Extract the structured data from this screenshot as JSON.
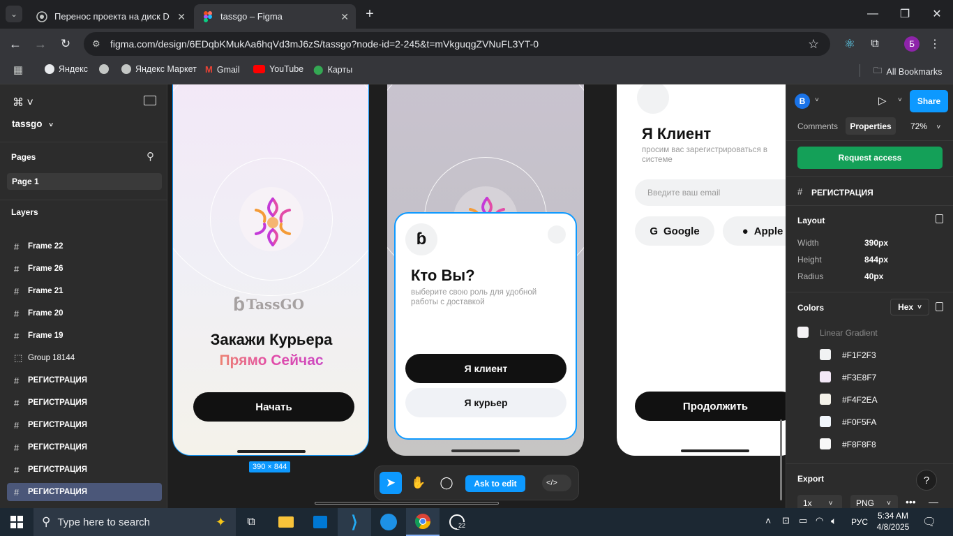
{
  "browser": {
    "tabs": [
      {
        "title": "Перенос проекта на диск D",
        "active": false
      },
      {
        "title": "tassgo – Figma",
        "active": true
      }
    ],
    "url": "figma.com/design/6EDqbKMukAa6hqVd3mJ6zS/tassgo?node-id=2-245&t=mVkguqgZVNuFL3YT-0",
    "profile_letter": "Б",
    "bookmarks": [
      "Яндекс",
      "Яндекс Маркет",
      "Gmail",
      "YouTube",
      "Карты"
    ],
    "all_bookmarks": "All Bookmarks"
  },
  "figma": {
    "file_name": "tassgo",
    "pages_heading": "Pages",
    "page_1": "Page 1",
    "layers_heading": "Layers",
    "layers": [
      {
        "name": "Frame 22",
        "kind": "frame"
      },
      {
        "name": "Frame 26",
        "kind": "frame"
      },
      {
        "name": "Frame 21",
        "kind": "frame"
      },
      {
        "name": "Frame 20",
        "kind": "frame"
      },
      {
        "name": "Frame 19",
        "kind": "frame"
      },
      {
        "name": "Group 18144",
        "kind": "group"
      },
      {
        "name": "РЕГИСТРАЦИЯ",
        "kind": "frame"
      },
      {
        "name": "РЕГИСТРАЦИЯ",
        "kind": "frame"
      },
      {
        "name": "РЕГИСТРАЦИЯ",
        "kind": "frame"
      },
      {
        "name": "РЕГИСТРАЦИЯ",
        "kind": "frame"
      },
      {
        "name": "РЕГИСТРАЦИЯ",
        "kind": "frame"
      },
      {
        "name": "РЕГИСТРАЦИЯ",
        "kind": "frame",
        "selected": true
      }
    ],
    "canvas": {
      "frame1": {
        "logo_text": "TassGO",
        "headline1": "Закажи Курьера",
        "headline2": "Прямо Сейчас",
        "button": "Начать",
        "size_badge": "390 × 844"
      },
      "frame2": {
        "title": "Кто Вы?",
        "subtitle": "выберите свою роль для удобной работы с доставкой",
        "btn_client": "Я клиент",
        "btn_courier": "Я курьер"
      },
      "frame3": {
        "title": "Я Клиент",
        "subtitle": "просим вас зарегистрироваться в системе",
        "email_placeholder": "Введите ваш email",
        "google": "Google",
        "apple": "Apple",
        "continue": "Продолжить"
      }
    },
    "bottom_toolbar": {
      "ask_to_edit": "Ask to edit"
    },
    "right": {
      "avatar": "B",
      "share": "Share",
      "tab_comments": "Comments",
      "tab_properties": "Properties",
      "zoom": "72%",
      "request_access": "Request access",
      "selection_name": "РЕГИСТРАЦИЯ",
      "layout_heading": "Layout",
      "width_label": "Width",
      "width_value": "390px",
      "height_label": "Height",
      "height_value": "844px",
      "radius_label": "Radius",
      "radius_value": "40px",
      "colors_heading": "Colors",
      "color_format": "Hex",
      "gradient_label": "Linear Gradient",
      "colors": [
        "#F1F2F3",
        "#F3E8F7",
        "#F4F2EA",
        "#F0F5FA",
        "#F8F8F8"
      ],
      "export_heading": "Export",
      "export_scale": "1x",
      "export_format": "PNG"
    }
  },
  "taskbar": {
    "search_placeholder": "Type here to search",
    "language": "РУС",
    "time": "5:34 AM",
    "date": "4/8/2025",
    "badge": "22"
  },
  "colors": {
    "accent": "#0d99ff",
    "request_green": "#14a058",
    "chrome_dark": "#202124"
  }
}
